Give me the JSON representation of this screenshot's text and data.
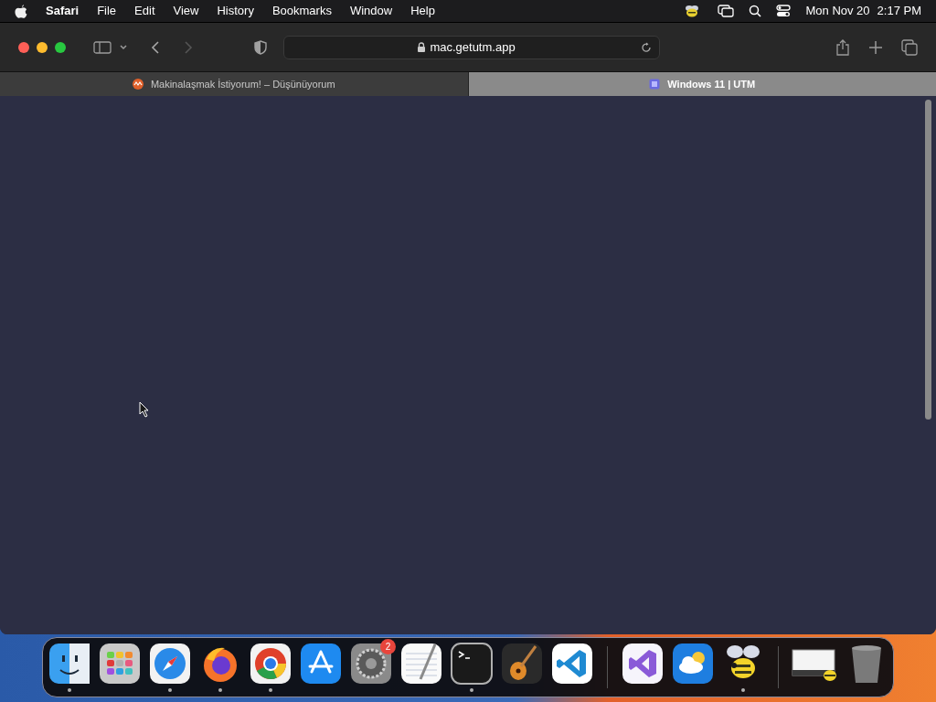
{
  "menu_bar": {
    "app": "Safari",
    "menus": [
      "File",
      "Edit",
      "View",
      "History",
      "Bookmarks",
      "Window",
      "Help"
    ],
    "date": "Mon Nov 20",
    "time": "2:17 PM"
  },
  "toolbar": {
    "address": "mac.getutm.app"
  },
  "tabs": [
    {
      "title": "Makinalaşmak İstiyorum! – Düşünüyorum",
      "selected": false
    },
    {
      "title": "Windows 11 | UTM",
      "selected": true
    }
  ],
  "dock": {
    "sections": [
      [
        {
          "running": true
        },
        {
          "running": false
        },
        {
          "running": true
        },
        {
          "running": true
        },
        {
          "running": true
        },
        {
          "running": false
        },
        {
          "running": false,
          "badge": "2"
        },
        {
          "running": false
        },
        {
          "running": true
        },
        {
          "running": false
        },
        {
          "running": false
        }
      ],
      [
        {
          "running": false
        },
        {
          "running": false
        },
        {
          "running": true
        }
      ],
      [
        {
          "running": false
        },
        {
          "running": false
        }
      ]
    ]
  }
}
